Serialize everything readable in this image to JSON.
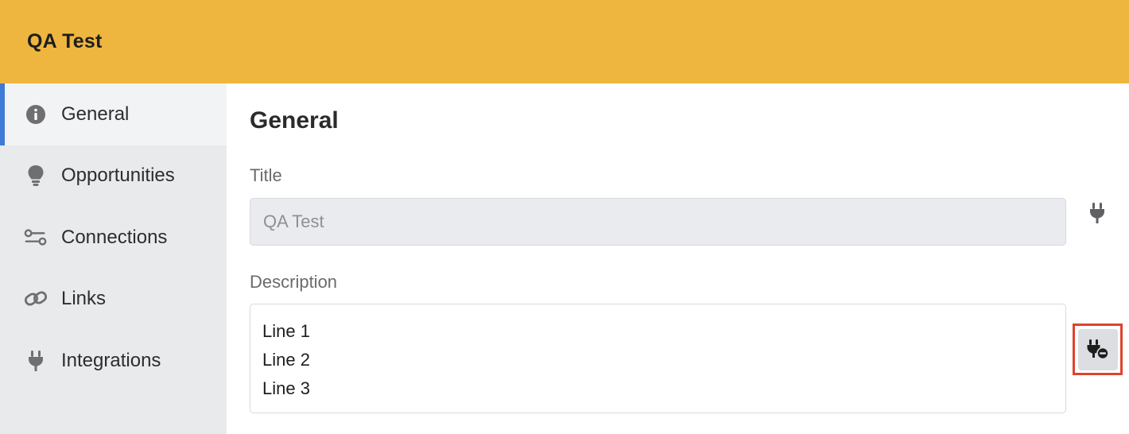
{
  "header": {
    "title": "QA Test"
  },
  "sidebar": {
    "items": [
      {
        "label": "General",
        "icon": "info-circle-icon",
        "active": true
      },
      {
        "label": "Opportunities",
        "icon": "lightbulb-icon",
        "active": false
      },
      {
        "label": "Connections",
        "icon": "connections-icon",
        "active": false
      },
      {
        "label": "Links",
        "icon": "link-icon",
        "active": false
      },
      {
        "label": "Integrations",
        "icon": "plug-icon",
        "active": false
      }
    ]
  },
  "main": {
    "section_title": "General",
    "title_field": {
      "label": "Title",
      "value": "QA Test"
    },
    "description_field": {
      "label": "Description",
      "lines": [
        "Line 1",
        "Line 2",
        "Line 3"
      ]
    }
  },
  "colors": {
    "header_bg": "#efb63f",
    "active_indicator": "#3f7ad6",
    "highlight_border": "#e0432c"
  }
}
